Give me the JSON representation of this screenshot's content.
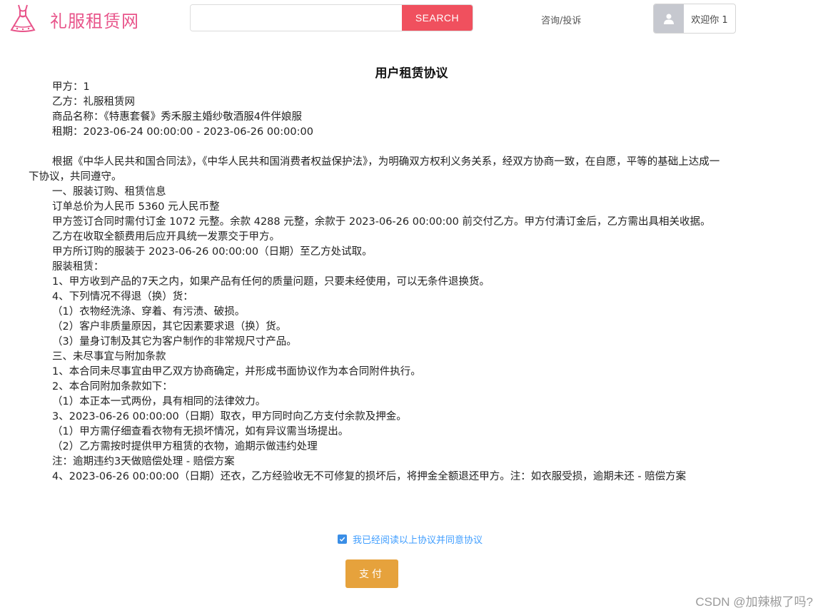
{
  "header": {
    "brand": "礼服租赁网",
    "search_placeholder": "",
    "search_button": "SEARCH",
    "consult_link": "咨询/投诉",
    "welcome": "欢迎你 1"
  },
  "agreement": {
    "title": "用户租赁协议",
    "info": [
      "甲方：1",
      "乙方：礼服租赁网",
      "商品名称：《特惠套餐》秀禾服主婚纱敬酒服4件伴娘服",
      "租期：2023-06-24 00:00:00 - 2023-06-26 00:00:00"
    ],
    "body": [
      "根据《中华人民共和国合同法》，《中华人民共和国消费者权益保护法》，为明确双方权利义务关系，经双方协商一致，在自愿，平等的基础上达成一下协议，共同遵守。",
      "一、服装订购、租赁信息",
      "订单总价为人民币 5360 元人民币整",
      "甲方签订合同时需付订金 1072 元整。余款 4288 元整，余款于 2023-06-26 00:00:00 前交付乙方。甲方付清订金后，乙方需出具相关收据。",
      "乙方在收取全额费用后应开具统一发票交于甲方。",
      "甲方所订购的服装于 2023-06-26 00:00:00（日期）至乙方处试取。",
      "服装租赁：",
      "1、甲方收到产品的7天之内，如果产品有任何的质量问题，只要未经使用，可以无条件退换货。",
      "4、下列情况不得退（换）货：",
      "（1）衣物经洗涤、穿着、有污渍、破损。",
      "（2）客户非质量原因，其它因素要求退（换）货。",
      "（3）量身订制及其它为客户制作的非常规尺寸产品。",
      "三、未尽事宜与附加条款",
      "1、本合同未尽事宜由甲乙双方协商确定，并形成书面协议作为本合同附件执行。",
      "2、本合同附加条款如下：",
      "（1）本正本一式两份，具有相同的法律效力。",
      "3、2023-06-26 00:00:00（日期）取衣，甲方同时向乙方支付余款及押金。",
      "（1）甲方需仔细查看衣物有无损坏情况，如有异议需当场提出。",
      "（2）乙方需按时提供甲方租赁的衣物，逾期示做违约处理",
      "注：逾期违约3天做赔偿处理 - 赔偿方案",
      "4、2023-06-26 00:00:00（日期）还衣，乙方经验收无不可修复的损坏后，将押金全额退还甲方。注：如衣服受损，逾期未还 - 赔偿方案"
    ]
  },
  "agree": {
    "checked": true,
    "label": "我已经阅读以上协议并同意协议"
  },
  "pay_button": "支付",
  "watermark": "CSDN @加辣椒了吗?",
  "colors": {
    "brand": "#e8548a",
    "search": "#f0505e",
    "pay": "#e6a23c",
    "link": "#409eff"
  }
}
